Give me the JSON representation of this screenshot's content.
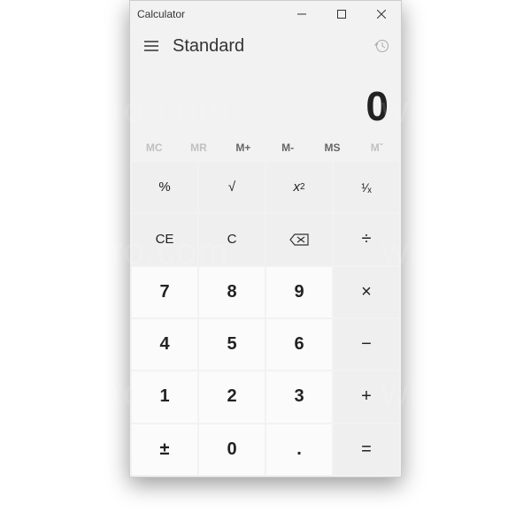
{
  "titlebar": {
    "title": "Calculator"
  },
  "header": {
    "mode": "Standard"
  },
  "display": {
    "value": "0"
  },
  "memory": {
    "mc": "MC",
    "mr": "MR",
    "mplus": "M+",
    "mminus": "M-",
    "ms": "MS",
    "mlist": "Mˇ"
  },
  "keys": {
    "percent": "%",
    "sqrt": "√",
    "square_base": "x",
    "square_exp": "2",
    "reciprocal": "¹⁄ₓ",
    "ce": "CE",
    "c": "C",
    "divide": "÷",
    "multiply": "×",
    "minus": "−",
    "plus": "+",
    "equals": "=",
    "plusminus": "±",
    "decimal": ".",
    "n0": "0",
    "n1": "1",
    "n2": "2",
    "n3": "3",
    "n4": "4",
    "n5": "5",
    "n6": "6",
    "n7": "7",
    "n8": "8",
    "n9": "9"
  }
}
